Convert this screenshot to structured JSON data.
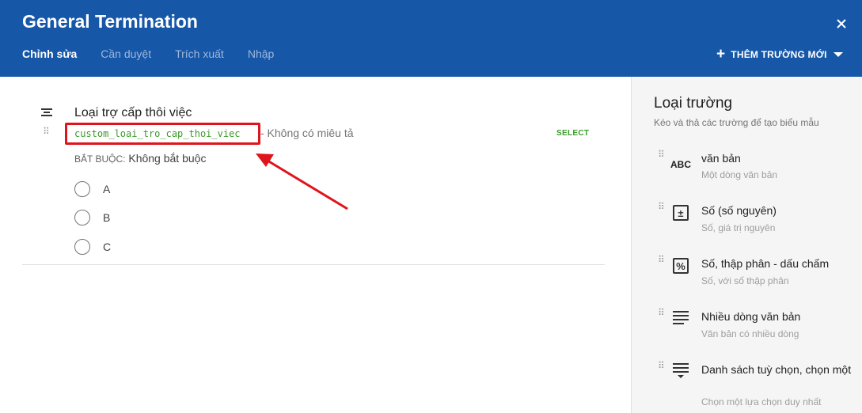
{
  "header": {
    "title": "General Termination",
    "tabs": [
      {
        "label": "Chỉnh sửa",
        "active": true
      },
      {
        "label": "Cần duyệt",
        "active": false
      },
      {
        "label": "Trích xuất",
        "active": false
      },
      {
        "label": "Nhập",
        "active": false
      }
    ],
    "add_field_label": "THÊM TRƯỜNG MỚI",
    "background_color": "#1657a8"
  },
  "field": {
    "label": "Loại trợ cấp thôi việc",
    "key": "custom_loai_tro_cap_thoi_viec",
    "description": "- Không có miêu tả",
    "type_tag": "SELECT",
    "required_key": "BẮT BUỘC:",
    "required_value": "Không bắt buộc",
    "options": [
      "A",
      "B",
      "C"
    ],
    "key_color": "#3c9a2b",
    "highlight_color": "#e0141c"
  },
  "sidebar": {
    "title": "Loại trường",
    "subtitle": "Kéo và thả các trường để tạo biểu mẫu",
    "items": [
      {
        "name": "văn bản",
        "desc": "Một dòng văn bản",
        "icon": "abc-icon",
        "icon_text": "ABC"
      },
      {
        "name": "Số (số nguyên)",
        "desc": "Số, giá trị nguyên",
        "icon": "plus-minus-box-icon",
        "icon_text": "±"
      },
      {
        "name": "Số, thập phân - dấu chấm",
        "desc": "Số, với số thập phân",
        "icon": "percent-box-icon",
        "icon_text": "%"
      },
      {
        "name": "Nhiều dòng văn bản",
        "desc": "Văn bản có nhiều dòng",
        "icon": "multiline-text-icon"
      },
      {
        "name": "Danh sách tuỳ chọn, chọn một",
        "desc": "Chọn một lựa chọn duy nhất",
        "icon": "select-list-icon"
      }
    ]
  }
}
